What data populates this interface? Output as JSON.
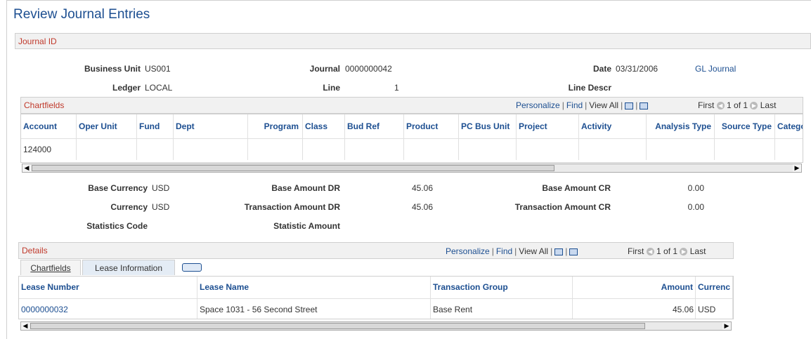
{
  "page": {
    "title": "Review Journal Entries"
  },
  "journal_section": {
    "title": "Journal ID"
  },
  "header_fields": {
    "business_unit": {
      "label": "Business Unit",
      "value": "US001"
    },
    "journal": {
      "label": "Journal",
      "value": "0000000042"
    },
    "date": {
      "label": "Date",
      "value": "03/31/2006"
    },
    "gl_journal_link": "GL Journal",
    "ledger": {
      "label": "Ledger",
      "value": "LOCAL"
    },
    "line": {
      "label": "Line",
      "value": "1"
    },
    "line_descr": {
      "label": "Line Descr",
      "value": ""
    }
  },
  "chartfields_grid": {
    "title": "Chartfields",
    "nav": {
      "personalize": "Personalize",
      "find": "Find",
      "view_all": "View All",
      "first": "First",
      "range": "1 of 1",
      "last": "Last"
    },
    "columns": [
      "Account",
      "Oper Unit",
      "Fund",
      "Dept",
      "Program",
      "Class",
      "Bud Ref",
      "Product",
      "PC Bus Unit",
      "Project",
      "Activity",
      "Analysis Type",
      "Source Type",
      "Catego"
    ],
    "rows": [
      [
        "124000",
        "",
        "",
        "",
        "",
        "",
        "",
        "",
        "",
        "",
        "",
        "",
        "",
        ""
      ]
    ]
  },
  "amounts": {
    "base_currency": {
      "label": "Base Currency",
      "value": "USD"
    },
    "base_amount_dr": {
      "label": "Base Amount DR",
      "value": "45.06"
    },
    "base_amount_cr": {
      "label": "Base Amount CR",
      "value": "0.00"
    },
    "currency": {
      "label": "Currency",
      "value": "USD"
    },
    "transaction_amount_dr": {
      "label": "Transaction Amount DR",
      "value": "45.06"
    },
    "transaction_amount_cr": {
      "label": "Transaction Amount CR",
      "value": "0.00"
    },
    "statistics_code": {
      "label": "Statistics Code",
      "value": ""
    },
    "statistic_amount": {
      "label": "Statistic Amount",
      "value": ""
    }
  },
  "details_grid": {
    "title": "Details",
    "nav": {
      "personalize": "Personalize",
      "find": "Find",
      "view_all": "View All",
      "first": "First",
      "range": "1 of 1",
      "last": "Last"
    },
    "tabs": [
      {
        "label": "Chartfields"
      },
      {
        "label": "Lease Information"
      }
    ],
    "columns": [
      "Lease Number",
      "Lease Name",
      "Transaction Group",
      "Amount",
      "Currenc"
    ],
    "rows": [
      {
        "lease_number": "0000000032",
        "lease_name": "Space 1031 - 56 Second Street",
        "transaction_group": "Base Rent",
        "amount": "45.06",
        "currency": "USD"
      }
    ]
  },
  "colors": {
    "link": "#1d4f91",
    "section_title": "#c0392b",
    "header_bg": "#f1f1f1"
  }
}
